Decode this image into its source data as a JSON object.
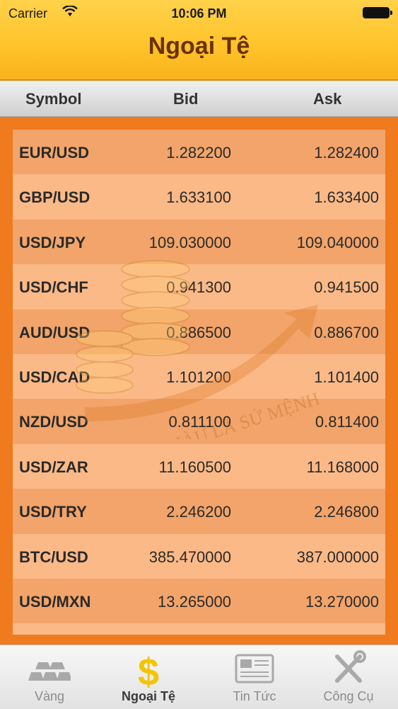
{
  "status_bar": {
    "carrier": "Carrier",
    "time": "10:06 PM"
  },
  "header": {
    "title": "Ngoại Tệ"
  },
  "columns": {
    "symbol": "Symbol",
    "bid": "Bid",
    "ask": "Ask"
  },
  "rows": [
    {
      "symbol": "EUR/USD",
      "bid": "1.282200",
      "ask": "1.282400"
    },
    {
      "symbol": "GBP/USD",
      "bid": "1.633100",
      "ask": "1.633400"
    },
    {
      "symbol": "USD/JPY",
      "bid": "109.030000",
      "ask": "109.040000"
    },
    {
      "symbol": "USD/CHF",
      "bid": "0.941300",
      "ask": "0.941500"
    },
    {
      "symbol": "AUD/USD",
      "bid": "0.886500",
      "ask": "0.886700"
    },
    {
      "symbol": "USD/CAD",
      "bid": "1.101200",
      "ask": "1.101400"
    },
    {
      "symbol": "NZD/USD",
      "bid": "0.811100",
      "ask": "0.811400"
    },
    {
      "symbol": "USD/ZAR",
      "bid": "11.160500",
      "ask": "11.168000"
    },
    {
      "symbol": "USD/TRY",
      "bid": "2.246200",
      "ask": "2.246800"
    },
    {
      "symbol": "BTC/USD",
      "bid": "385.470000",
      "ask": "387.000000"
    },
    {
      "symbol": "USD/MXN",
      "bid": "13.265000",
      "ask": "13.270000"
    }
  ],
  "watermark": {
    "text": "LÀM GIÀU LÀ SỨ MỆNH"
  },
  "tabs": [
    {
      "label": "Vàng",
      "icon": "gold-bars-icon",
      "active": false
    },
    {
      "label": "Ngoại Tệ",
      "icon": "dollar-icon",
      "active": true
    },
    {
      "label": "Tin Tức",
      "icon": "newspaper-icon",
      "active": false
    },
    {
      "label": "Công Cụ",
      "icon": "tools-icon",
      "active": false
    }
  ],
  "colors": {
    "accent": "#ffc42c",
    "background": "#f07a1e",
    "title": "#6b3100"
  }
}
